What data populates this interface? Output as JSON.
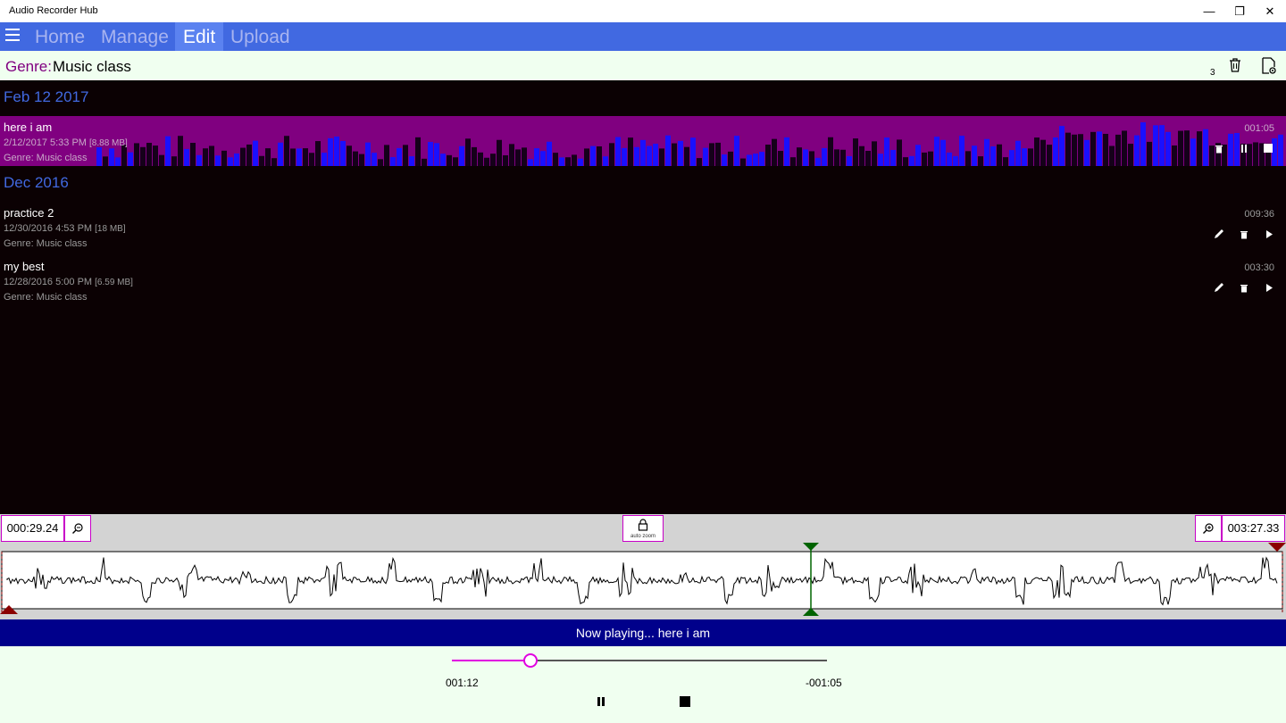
{
  "window": {
    "title": "Audio Recorder Hub",
    "controls": {
      "minimize": "—",
      "maximize": "❐",
      "close": "✕"
    }
  },
  "nav": {
    "tabs": [
      {
        "label": "Home"
      },
      {
        "label": "Manage"
      },
      {
        "label": "Edit",
        "active": true
      },
      {
        "label": "Upload"
      }
    ]
  },
  "genre_bar": {
    "label": "Genre:",
    "value": "Music class",
    "count": "3",
    "icons": [
      "trash-icon",
      "file-settings-icon"
    ]
  },
  "groups": [
    {
      "header": "Feb 12 2017",
      "recordings": [
        {
          "name": "here i am",
          "date": "2/12/2017 5:33 PM",
          "size": "[8.88 MB]",
          "genre": "Genre: Music class",
          "duration": "001:05",
          "playing": true
        }
      ]
    },
    {
      "header": "Dec 2016",
      "recordings": [
        {
          "name": "practice 2",
          "date": "12/30/2016 4:53 PM",
          "size": "[18 MB]",
          "genre": "Genre: Music class",
          "duration": "009:36"
        },
        {
          "name": "my best",
          "date": "12/28/2016 5:00 PM",
          "size": "[6.59 MB]",
          "genre": "Genre: Music class",
          "duration": "003:30"
        }
      ]
    }
  ],
  "editor": {
    "start_time": "000:29.24",
    "end_time": "003:27.33",
    "auto_zoom_label": "auto zoom"
  },
  "now_playing": "Now playing... here i am",
  "player": {
    "elapsed": "001:12",
    "remaining": "-001:05",
    "progress": 0.21
  },
  "colors": {
    "nav_bg": "#4169e1",
    "accent": "#800080",
    "playbar": "#00008b",
    "highlight": "#e000e0"
  }
}
